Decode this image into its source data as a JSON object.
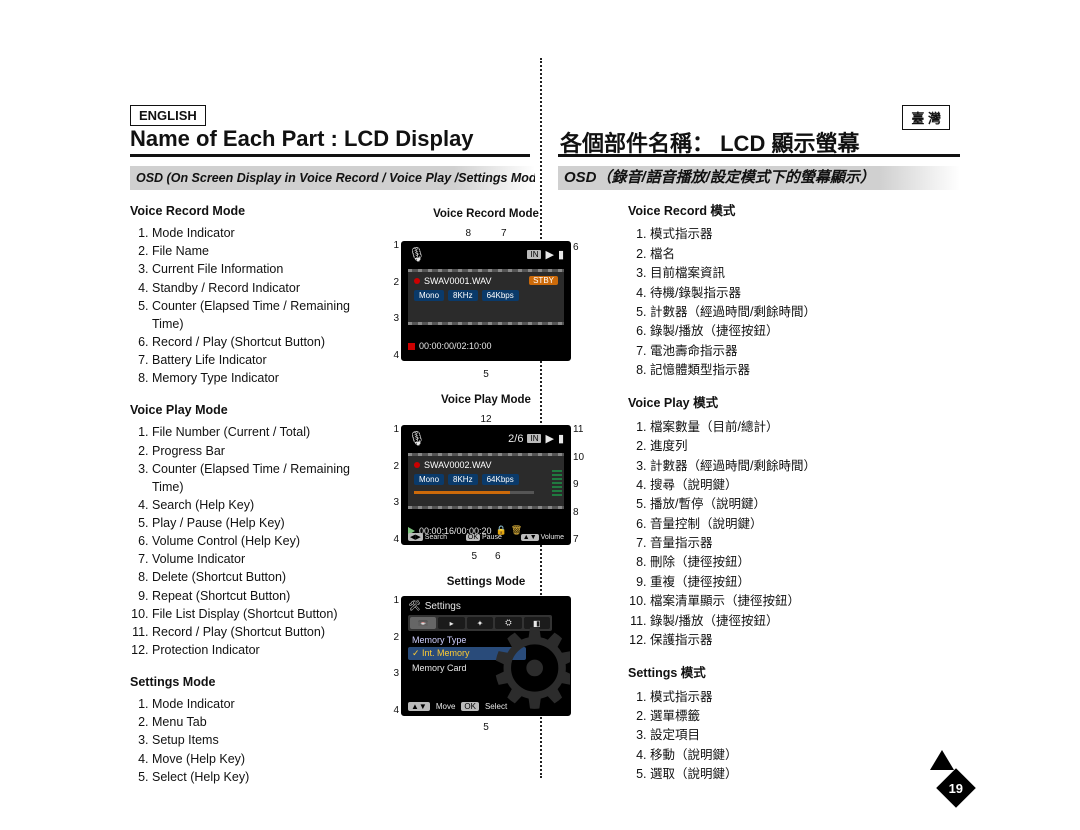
{
  "lang_left": "ENGLISH",
  "lang_right": "臺 灣",
  "title_left": "Name of Each Part : LCD Display",
  "title_right": "各個部件名稱： LCD 顯示螢幕",
  "subtitle_left": "OSD (On Screen Display in Voice Record / Voice Play /Settings Mode)",
  "subtitle_right": "OSD（錄音/語音播放/設定模式下的螢幕顯示）",
  "en": {
    "voice_record": {
      "head": "Voice Record Mode",
      "items": [
        "Mode Indicator",
        "File Name",
        "Current File Information",
        "Standby / Record Indicator",
        "Counter (Elapsed Time / Remaining Time)",
        "Record / Play (Shortcut Button)",
        "Battery Life Indicator",
        "Memory Type Indicator"
      ]
    },
    "voice_play": {
      "head": "Voice Play Mode",
      "items": [
        "File Number (Current / Total)",
        "Progress Bar",
        "Counter (Elapsed Time / Remaining Time)",
        "Search (Help Key)",
        "Play / Pause (Help Key)",
        "Volume Control (Help Key)",
        "Volume Indicator",
        "Delete (Shortcut Button)",
        "Repeat (Shortcut Button)",
        "File List Display (Shortcut Button)",
        "Record / Play (Shortcut Button)",
        "Protection Indicator"
      ]
    },
    "settings": {
      "head": "Settings Mode",
      "items": [
        "Mode Indicator",
        "Menu Tab",
        "Setup Items",
        "Move (Help Key)",
        "Select (Help Key)"
      ]
    }
  },
  "zh": {
    "voice_record": {
      "head": "Voice Record 模式",
      "items": [
        "模式指示器",
        "檔名",
        "目前檔案資訊",
        "待機/錄製指示器",
        "計數器（經過時間/剩餘時間）",
        "錄製/播放（捷徑按鈕）",
        "電池壽命指示器",
        "記憶體類型指示器"
      ]
    },
    "voice_play": {
      "head": "Voice Play 模式",
      "items": [
        "檔案數量（目前/總計）",
        "進度列",
        "計數器（經過時間/剩餘時間）",
        "搜尋（說明鍵）",
        "播放/暫停（說明鍵）",
        "音量控制（說明鍵）",
        "音量指示器",
        "刪除（捷徑按鈕）",
        "重複（捷徑按鈕）",
        "檔案清單顯示（捷徑按鈕）",
        "錄製/播放（捷徑按鈕）",
        "保護指示器"
      ]
    },
    "settings": {
      "head": "Settings 模式",
      "items": [
        "模式指示器",
        "選單標籤",
        "設定項目",
        "移動（說明鍵）",
        "選取（說明鍵）"
      ]
    }
  },
  "lcd": {
    "record": {
      "caption": "Voice Record Mode",
      "fname": "SWAV0001.WAV",
      "chips": [
        "Mono",
        "8KHz",
        "64Kbps"
      ],
      "stby": "STBY",
      "counter": "00:00:00/02:10:00",
      "card": "IN",
      "callout_top_left": "8",
      "callout_top_right": "7",
      "callout_left": [
        "1",
        "2",
        "3",
        "4"
      ],
      "callout_right": [
        "6"
      ],
      "callout_below": [
        "5"
      ]
    },
    "play": {
      "caption": "Voice Play Mode",
      "fname": "SWAV0002.WAV",
      "chips": [
        "Mono",
        "8KHz",
        "64Kbps"
      ],
      "count_label": "2/6",
      "card": "IN",
      "counter": "00:00:16/00:00:20",
      "help": {
        "search": "Search",
        "ok": "OK",
        "pause": "Pause",
        "vol": "Volume"
      },
      "callout_top": [
        "12"
      ],
      "callout_left": [
        "1",
        "2",
        "3",
        "4"
      ],
      "callout_right": [
        "11",
        "10",
        "9",
        "8",
        "7"
      ],
      "callout_below": [
        "5",
        "6"
      ]
    },
    "settings": {
      "caption": "Settings Mode",
      "title": "Settings",
      "menu_label": "Memory Type",
      "opt_sel": "Int. Memory",
      "opt2": "Memory Card",
      "move": "Move",
      "ok": "OK",
      "select": "Select",
      "callout_left": [
        "1",
        "2",
        "3",
        "4"
      ],
      "callout_below": [
        "5"
      ]
    }
  },
  "page_number": "19"
}
